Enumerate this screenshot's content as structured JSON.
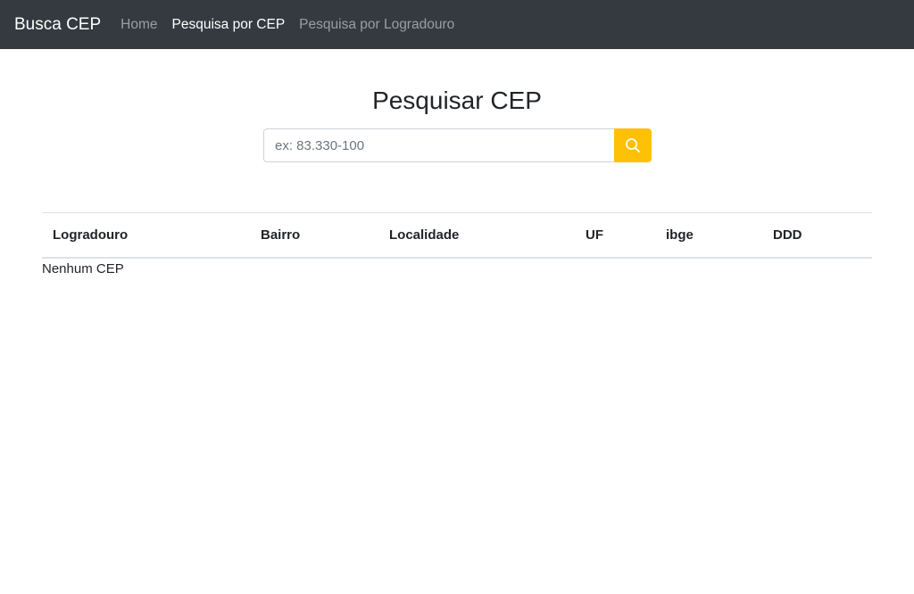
{
  "navbar": {
    "brand": "Busca CEP",
    "links": [
      {
        "label": "Home",
        "active": false
      },
      {
        "label": "Pesquisa por CEP",
        "active": true
      },
      {
        "label": "Pesquisa por Logradouro",
        "active": false
      }
    ]
  },
  "search": {
    "title": "Pesquisar CEP",
    "placeholder": "ex: 83.330-100",
    "value": "",
    "button_icon": "search-icon",
    "button_color": "#ffc107"
  },
  "table": {
    "headers": [
      "Logradouro",
      "Bairro",
      "Localidade",
      "UF",
      "ibge",
      "DDD"
    ],
    "empty_message": "Nenhum CEP"
  },
  "colors": {
    "navbar_bg": "#343a40",
    "accent": "#ffc107"
  }
}
